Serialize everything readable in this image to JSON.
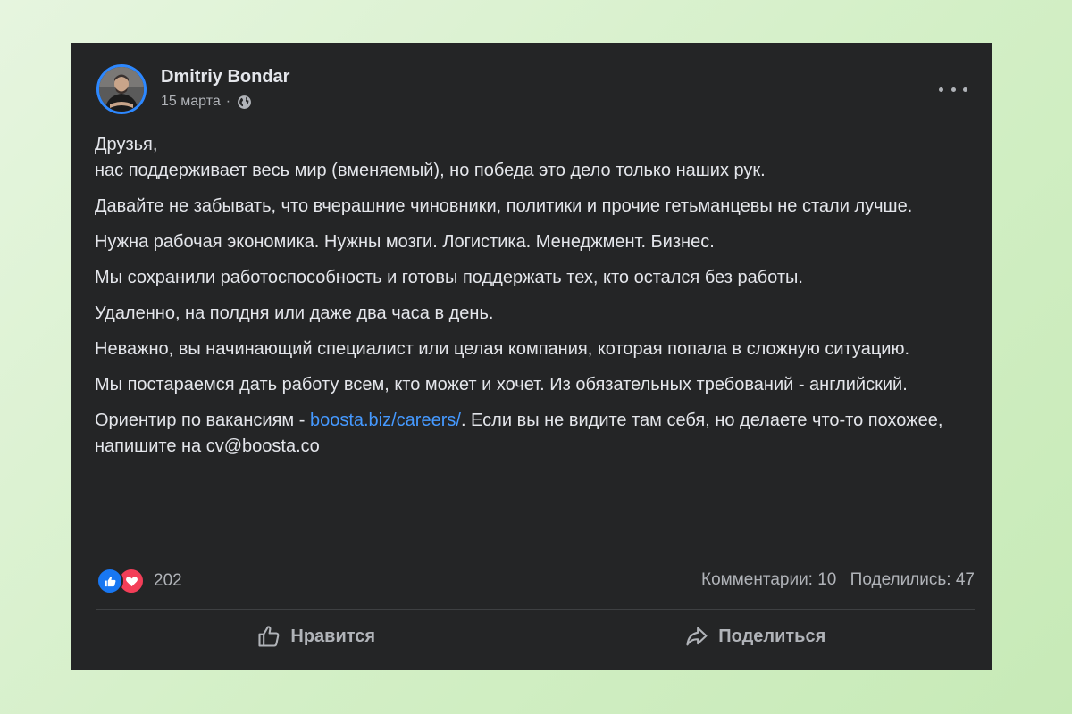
{
  "post": {
    "author": "Dmitriy Bondar",
    "date": "15 марта",
    "separator": "·",
    "privacy_icon": "globe-icon",
    "more_icon": "more-horizontal-icon",
    "paragraphs": [
      "Друзья,",
      "нас поддерживает весь мир (вменяемый), но победа это дело только наших рук.",
      "Давайте не забывать, что вчерашние чиновники, политики и прочие гетьманцевы не стали лучше.",
      "Нужна рабочая экономика. Нужны мозги. Логистика. Менеджмент. Бизнес.",
      "Мы сохранили работоспособность и готовы поддержать тех, кто остался без работы.",
      "Удаленно, на полдня или даже два часа в день.",
      "Неважно, вы начинающий специалист или целая компания, которая попала в сложную ситуацию.",
      "Мы постараемся дать работу всем, кто может и хочет. Из обязательных требований - английский."
    ],
    "last_paragraph": {
      "before_link": "Ориентир по вакансиям - ",
      "link_text": "boosta.biz/careers/",
      "after_link": ". Если вы не видите там себя, но делаете что-то похожее, напишите на cv@boosta.co"
    }
  },
  "stats": {
    "reaction_icons": [
      "like-reaction-icon",
      "love-reaction-icon"
    ],
    "reaction_count": "202",
    "comments": "Комментарии: 10",
    "shares": "Поделились: 47"
  },
  "actions": {
    "like_label": "Нравится",
    "share_label": "Поделиться"
  },
  "colors": {
    "card_background": "#242526",
    "page_background": "#d3efc6",
    "text_primary": "#e4e6eb",
    "text_secondary": "#b0b3b8",
    "link": "#4599ff",
    "like": "#1877f2",
    "love": "#f33e58",
    "avatar_ring": "#2d88ff"
  }
}
